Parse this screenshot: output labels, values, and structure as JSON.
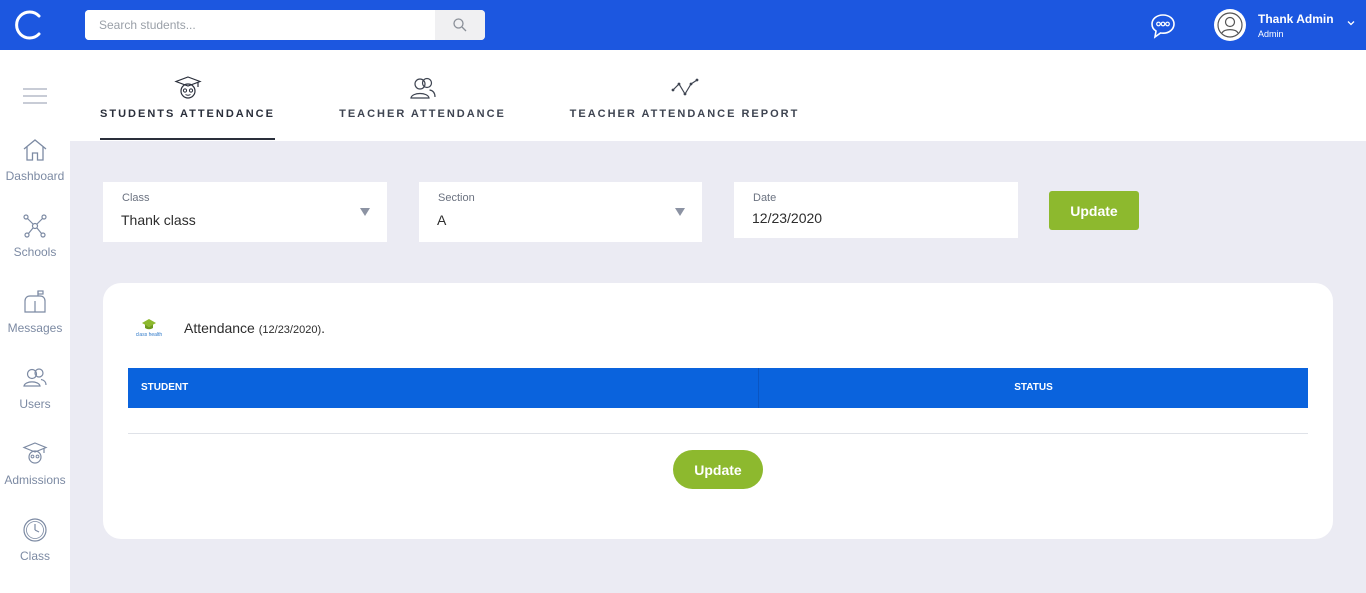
{
  "search": {
    "placeholder": "Search students..."
  },
  "user": {
    "name": "Thank Admin",
    "role": "Admin"
  },
  "sidebar": {
    "items": [
      {
        "label": "Dashboard",
        "icon": "home-icon"
      },
      {
        "label": "Schools",
        "icon": "network-icon"
      },
      {
        "label": "Messages",
        "icon": "mailbox-icon"
      },
      {
        "label": "Users",
        "icon": "users-icon"
      },
      {
        "label": "Admissions",
        "icon": "graduate-icon"
      },
      {
        "label": "Class",
        "icon": "clock-icon"
      }
    ]
  },
  "tabs": [
    {
      "label": "STUDENTS ATTENDANCE",
      "icon": "graduate-icon",
      "active": true
    },
    {
      "label": "TEACHER ATTENDANCE",
      "icon": "users-icon",
      "active": false
    },
    {
      "label": "TEACHER ATTENDANCE REPORT",
      "icon": "line-chart-icon",
      "active": false
    }
  ],
  "filters": {
    "class": {
      "label": "Class",
      "value": "Thank class"
    },
    "section": {
      "label": "Section",
      "value": "A"
    },
    "date": {
      "label": "Date",
      "value": "12/23/2020"
    },
    "update_label": "Update"
  },
  "card": {
    "title": "Attendance",
    "title_date": "(12/23/2020)",
    "title_suffix": ".",
    "logo_text": "class health",
    "columns": [
      "STUDENT",
      "STATUS"
    ],
    "update_label": "Update"
  },
  "colors": {
    "topbar": "#1c57e0",
    "table_header": "#0a63dd",
    "button_green": "#8db92e",
    "background": "#ebebf3"
  }
}
